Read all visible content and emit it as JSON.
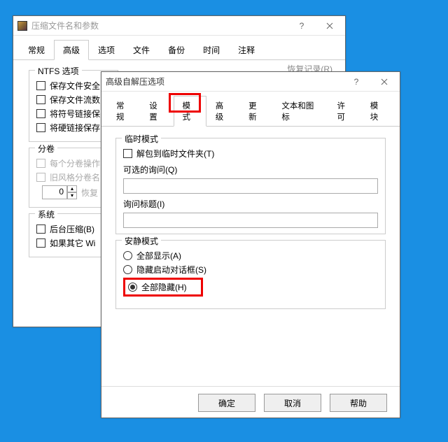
{
  "back": {
    "title": "压缩文件名和参数",
    "tabs": [
      "常规",
      "高级",
      "选项",
      "文件",
      "备份",
      "时间",
      "注释"
    ],
    "active_tab": 1,
    "group_ntfs": {
      "legend": "NTFS 选项",
      "items": [
        "保存文件安全",
        "保存文件流数",
        "将符号链接保",
        "将硬链接保存"
      ]
    },
    "recovery_label": "恢复记录(R)",
    "group_volume": {
      "legend": "分卷",
      "disabled_items": [
        "每个分卷操作",
        "旧风格分卷名"
      ],
      "spin_value": "0",
      "spin_label": "恢复"
    },
    "group_system": {
      "legend": "系统",
      "items": [
        "后台压缩(B)",
        "如果其它 Wi"
      ]
    }
  },
  "front": {
    "title": "高级自解压选项",
    "tabs": [
      "常规",
      "设置",
      "模式",
      "高级",
      "更新",
      "文本和图标",
      "许可",
      "模块"
    ],
    "active_tab": 2,
    "group_temp": {
      "legend": "临时模式",
      "unpack_label": "解包到临时文件夹(T)",
      "optional_q_label": "可选的询问(Q)",
      "title_label": "询问标题(I)"
    },
    "group_quiet": {
      "legend": "安静模式",
      "opt_show_all": "全部显示(A)",
      "opt_hide_start": "隐藏启动对话框(S)",
      "opt_hide_all": "全部隐藏(H)"
    },
    "buttons": {
      "ok": "确定",
      "cancel": "取消",
      "help": "帮助"
    }
  }
}
